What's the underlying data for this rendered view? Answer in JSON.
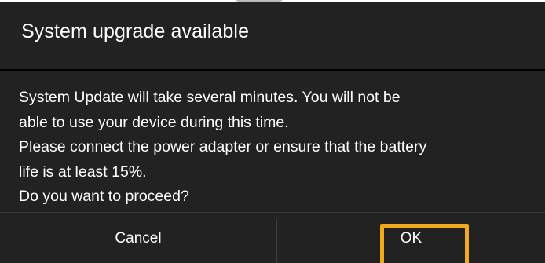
{
  "dialog": {
    "title": "System upgrade available",
    "message_lines": [
      "System Update will take several minutes. You will not be",
      "able to use your device during this time.",
      "Please connect the power adapter or ensure that the battery",
      "life is at least 15%.",
      "Do you want to proceed?"
    ],
    "buttons": {
      "cancel_label": "Cancel",
      "ok_label": "OK"
    }
  },
  "colors": {
    "dialog_background": "#222222",
    "text": "#ffffff",
    "highlight": "#f0aa1e"
  }
}
